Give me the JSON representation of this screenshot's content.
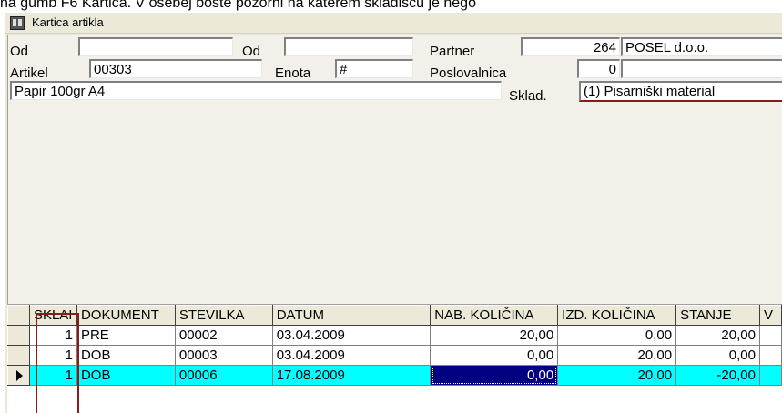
{
  "caption": "na gumb F6 Kartica. V osebej boste pozorni na katerem skladišcu je nego",
  "window": {
    "title": "Kartica artikla"
  },
  "form": {
    "od1_label": "Od",
    "od1_value": "",
    "od2_label": "Od",
    "od2_value": "",
    "partner_label": "Partner",
    "partner_code": "264",
    "partner_name": "POSEL d.o.o.",
    "artikel_label": "Artikel",
    "artikel_value": "00303",
    "enota_label": "Enota",
    "enota_value": "#",
    "poslovalnica_label": "Poslovalnica",
    "poslovalnica_code": "0",
    "poslovalnica_name": "",
    "opis_value": "Papir 100gr A4",
    "sklad_label": "Sklad.",
    "sklad_value": "(1) Pisarniški material"
  },
  "grid": {
    "columns": [
      "SKLAI",
      "DOKUMENT",
      "STEVILKA",
      "DATUM",
      "NAB. KOLIČINA",
      "IZD. KOLIČINA",
      "STANJE",
      "V"
    ],
    "rows": [
      {
        "sklad": "1",
        "dokument": "PRE",
        "stevilka": "00002",
        "datum": "03.04.2009",
        "nab": "20,00",
        "izd": "0,00",
        "stanje": "20,00",
        "v": ""
      },
      {
        "sklad": "1",
        "dokument": "DOB",
        "stevilka": "00003",
        "datum": "03.04.2009",
        "nab": "0,00",
        "izd": "20,00",
        "stanje": "0,00",
        "v": ""
      },
      {
        "sklad": "1",
        "dokument": "DOB",
        "stevilka": "00006",
        "datum": "17.08.2009",
        "nab": "0,00",
        "izd": "20,00",
        "stanje": "-20,00",
        "v": ""
      }
    ],
    "selected_row": 3
  },
  "colors": {
    "selected_row": "#00ffff",
    "focus_cell": "#000080",
    "highlight_box": "#8b1a1a"
  }
}
